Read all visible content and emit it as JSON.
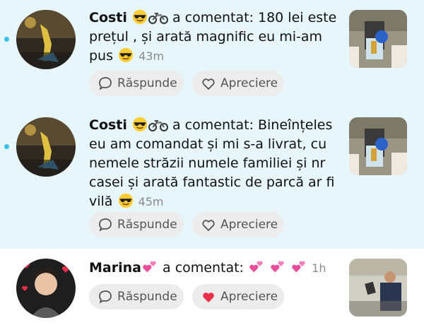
{
  "notifications": [
    {
      "user": "Costi",
      "action": "a comentat:",
      "comment": "180 lei este prețul , și arată magnific eu mi-am pus",
      "time": "43m",
      "unread": true,
      "reply_label": "Răspunde",
      "like_label": "Apreciere",
      "liked": false
    },
    {
      "user": "Costi",
      "action": "a comentat:",
      "comment": "Bineînțeles eu am comandat și mi s-a livrat, cu nemele străzii numele familiei și nr casei și arată fantastic de parcă ar fi vilă",
      "time": "45m",
      "unread": true,
      "reply_label": "Răspunde",
      "like_label": "Apreciere",
      "liked": false
    },
    {
      "user": "Marina",
      "action": "a comentat:",
      "comment": "",
      "time": "1h",
      "unread": false,
      "reply_label": "Răspunde",
      "like_label": "Apreciere",
      "liked": true
    }
  ],
  "colors": {
    "unread_bg": "#e7f6fb",
    "unread_dot": "#3cc1ea",
    "like_red": "#e8304a",
    "button_bg": "#ececec"
  },
  "icons": [
    "sunglasses-emoji",
    "motorcycle-emoji",
    "two-hearts-emoji",
    "revolving-hearts-emoji",
    "speech-bubble-icon",
    "heart-icon"
  ]
}
